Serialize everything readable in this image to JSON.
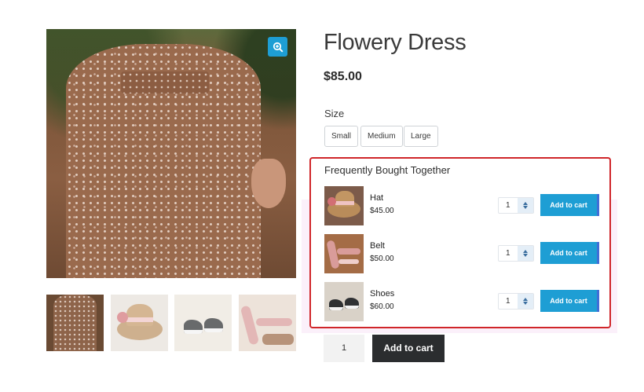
{
  "product": {
    "title": "Flowery Dress",
    "price": "$85.00",
    "size_label": "Size",
    "sizes": [
      "Small",
      "Medium",
      "Large"
    ],
    "quantity": "1",
    "add_to_cart_label": "Add to cart"
  },
  "gallery": {
    "zoom_icon": "zoom-in-icon",
    "thumbnails": [
      "dress",
      "hat",
      "shoes",
      "belt"
    ]
  },
  "fbt": {
    "title": "Frequently Bought Together",
    "items": [
      {
        "name": "Hat",
        "price": "$45.00",
        "quantity": "1",
        "button_label": "Add to cart"
      },
      {
        "name": "Belt",
        "price": "$50.00",
        "quantity": "1",
        "button_label": "Add to cart"
      },
      {
        "name": "Shoes",
        "price": "$60.00",
        "quantity": "1",
        "button_label": "Add to cart"
      }
    ]
  },
  "colors": {
    "accent": "#1e9ed4",
    "highlight_border": "#d0262a",
    "dark_button": "#2b2d2f"
  }
}
